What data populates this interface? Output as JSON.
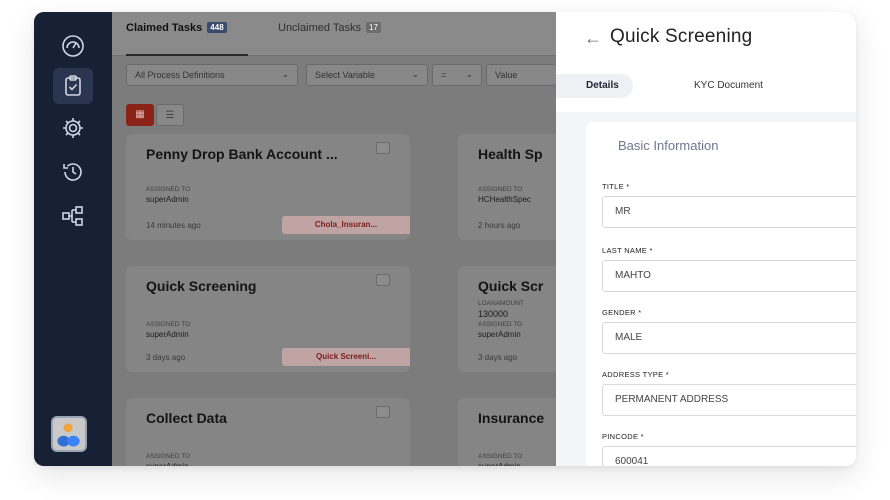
{
  "main": {
    "tabs": [
      {
        "label": "Claimed Tasks",
        "badge": "448"
      },
      {
        "label": "Unclaimed Tasks",
        "badge": "17"
      }
    ],
    "filters": [
      {
        "label": "All Process Definitions"
      },
      {
        "label": "Select Variable"
      },
      {
        "label": "="
      },
      {
        "label": "Value"
      }
    ],
    "view_toggle": {
      "grid_icon": "grid-icon",
      "list_icon": "list-icon"
    },
    "cards": [
      {
        "title": "Penny Drop Bank Account ...",
        "assigned_label": "ASSIGNED TO",
        "assigned": "superAdmin",
        "time": "14 minutes ago",
        "pill": "Chola_Insuran..."
      },
      {
        "title": "Health Sp",
        "assigned_label": "ASSIGNED TO",
        "assigned": "HCHealthSpec",
        "time": "2 hours ago"
      },
      {
        "title": "Quick Screening",
        "assigned_label": "ASSIGNED TO",
        "assigned": "superAdmin",
        "time": "3 days ago",
        "pill": "Quick Screeni..."
      },
      {
        "title": "Quick Scr",
        "extra_label": "LOANAMOUNT",
        "extra_value": "130000",
        "assigned_label": "ASSIGNED TO",
        "assigned": "superAdmin",
        "time": "3 days ago"
      },
      {
        "title": "Collect Data",
        "assigned_label": "ASSIGNED TO",
        "assigned": "superAdmin"
      },
      {
        "title": "Insurance",
        "assigned_label": "ASSIGNED TO",
        "assigned": "superAdmin"
      }
    ]
  },
  "drawer": {
    "title": "Quick Screening",
    "tabs": [
      {
        "label": "Details"
      },
      {
        "label": "KYC Document"
      }
    ],
    "section_title": "Basic Information",
    "fields": [
      {
        "label": "TITLE *",
        "value": "MR"
      },
      {
        "label": "LAST NAME *",
        "value": "MAHTO"
      },
      {
        "label": "GENDER *",
        "value": "MALE"
      },
      {
        "label": "ADDRESS TYPE *",
        "value": "PERMANENT ADDRESS"
      },
      {
        "label": "PINCODE *",
        "value": "600041"
      }
    ]
  },
  "colors": {
    "sidebar": "#172136",
    "accent_red": "#8a2218",
    "overlay": "#7c7c7c",
    "drawer_bg": "#ffffff"
  }
}
